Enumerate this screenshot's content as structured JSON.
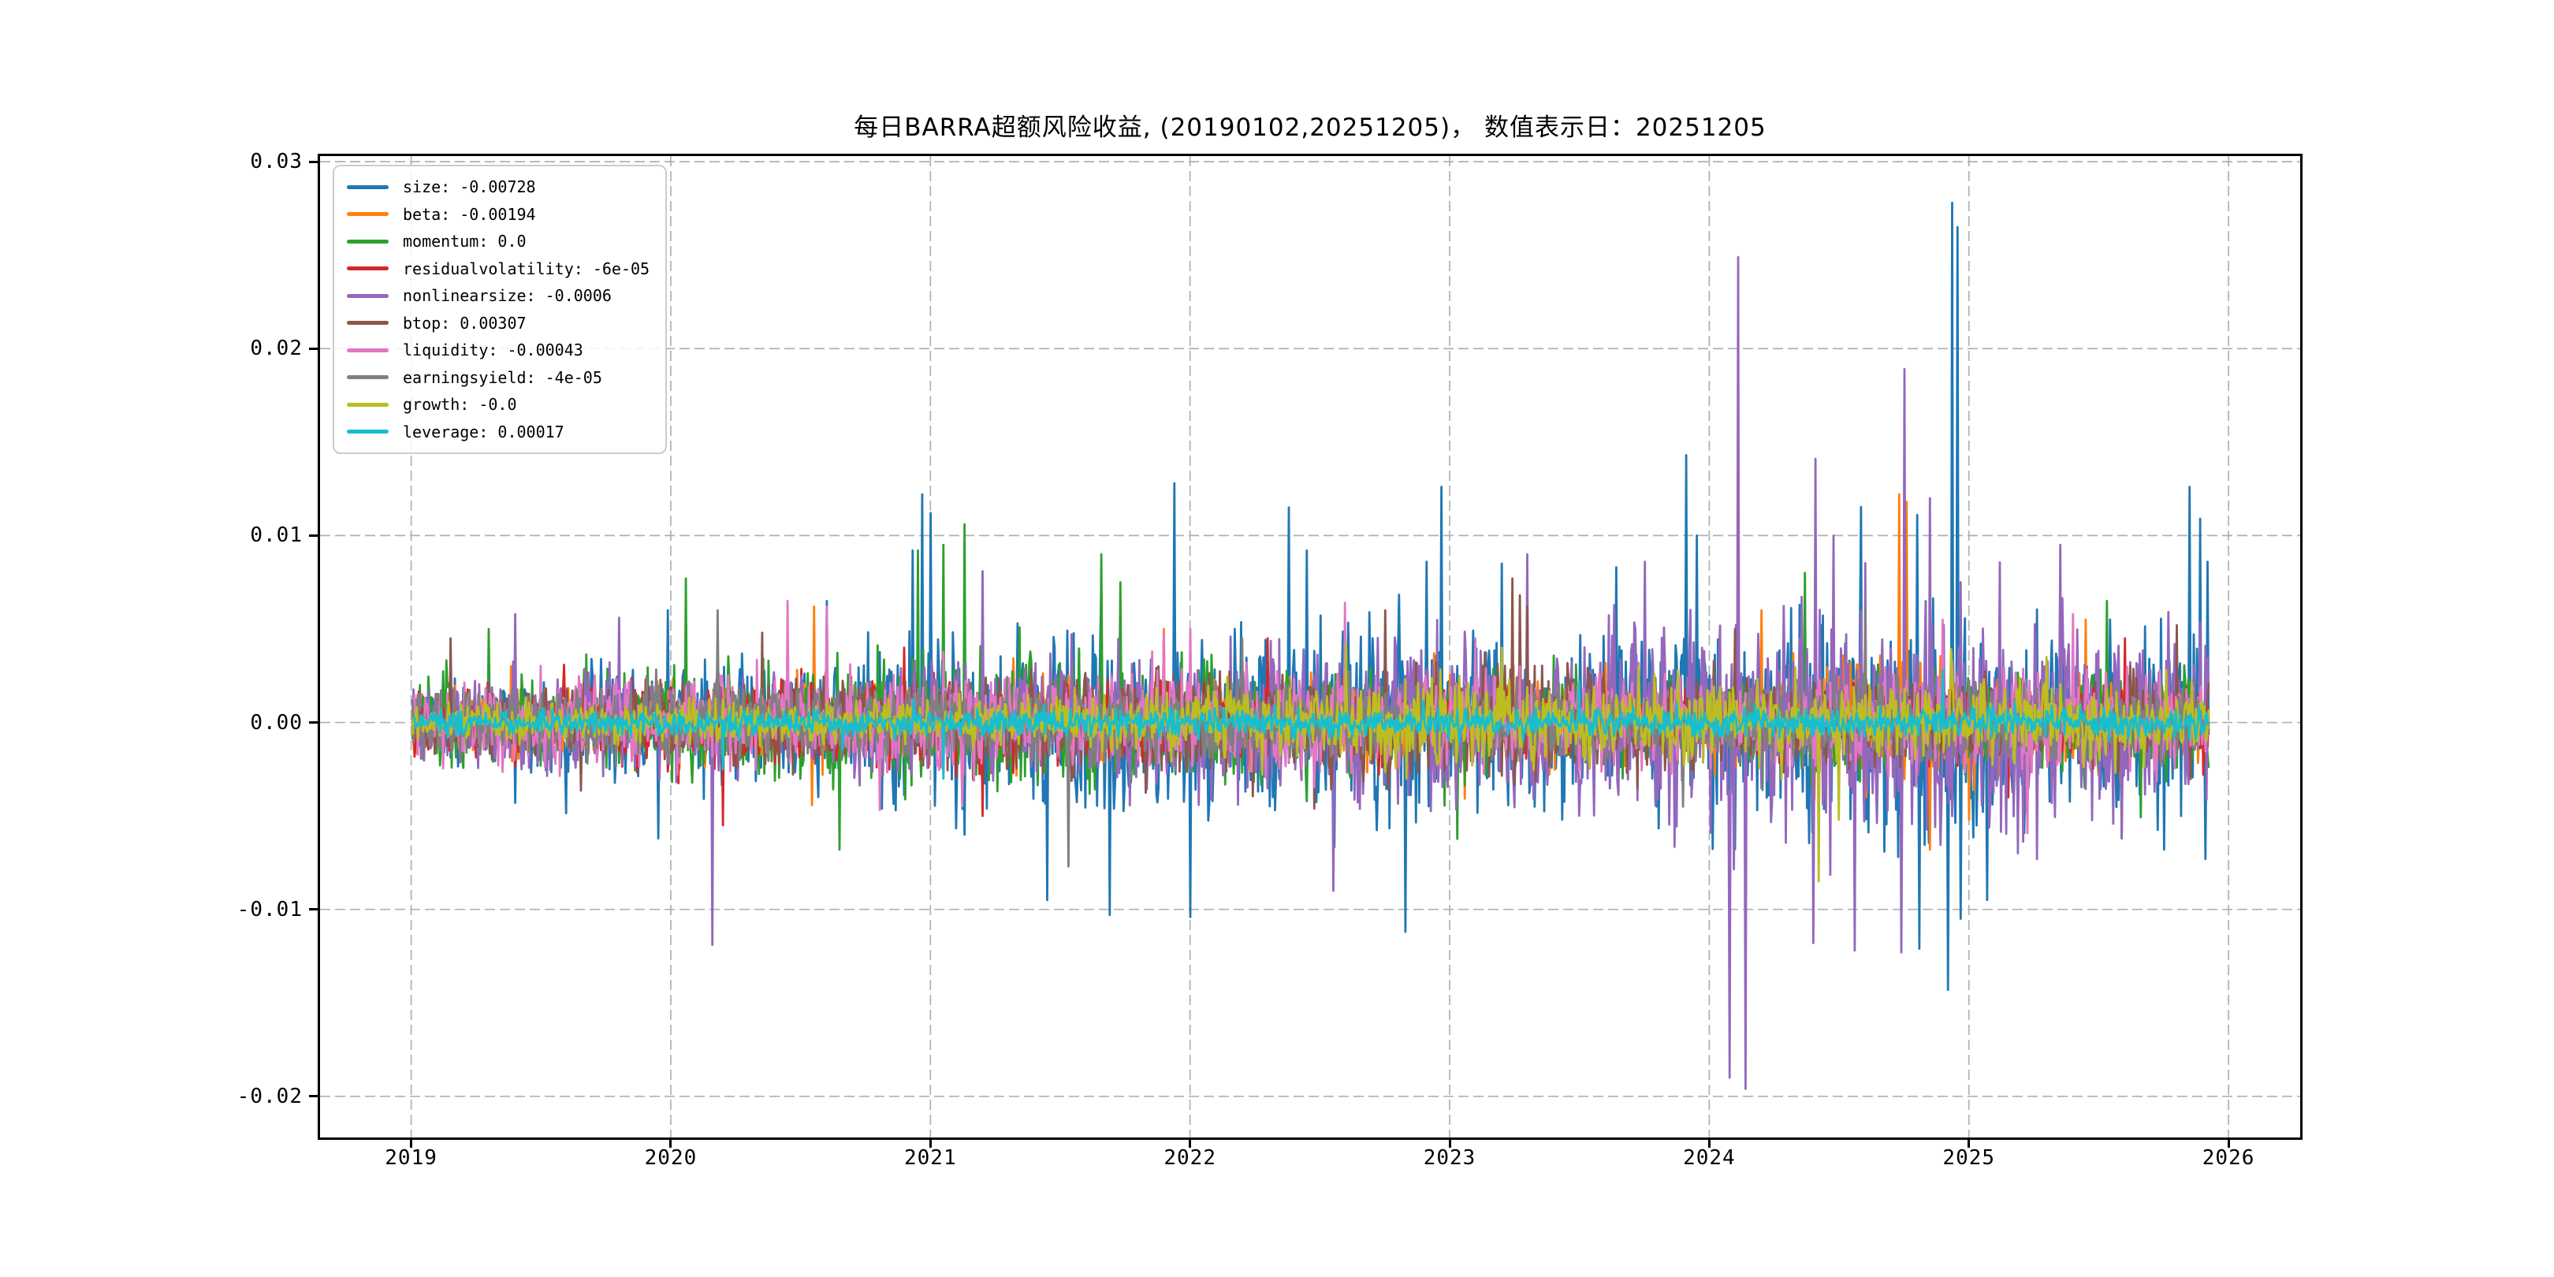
{
  "chart_data": {
    "type": "line",
    "title": "每日BARRA超额风险收益, (20190102,20251205)， 数值表示日：20251205",
    "xlabel": "",
    "ylabel": "",
    "date_range": [
      "20190102",
      "20251205"
    ],
    "value_date": "20251205",
    "x_axis": {
      "unit": "year",
      "ticks": [
        2019,
        2020,
        2021,
        2022,
        2023,
        2024,
        2025,
        2026
      ],
      "lim": [
        2018.649,
        2026.276
      ]
    },
    "y_axis": {
      "ticks": [
        0.03,
        0.02,
        0.01,
        0.0,
        -0.01,
        -0.02
      ],
      "tick_labels": [
        "0.03",
        "0.02",
        "0.01",
        "0.00",
        "-0.01",
        "-0.02"
      ],
      "lim": [
        -0.0222,
        0.0303
      ]
    },
    "grid": {
      "show": true,
      "style": "dashed",
      "color": "#b0b0b0"
    },
    "legend": {
      "position": "upper left"
    },
    "points_per_year": 245,
    "data_start": 2019.005,
    "data_end": 2025.925,
    "series": [
      {
        "name": "size",
        "color": "#1f77b4",
        "last_value": -0.00728,
        "label": "size: -0.00728",
        "amp_envelope": [
          [
            2018.99,
            0.0011
          ],
          [
            2019.9,
            0.0013
          ],
          [
            2020.5,
            0.0016
          ],
          [
            2020.9,
            0.0022
          ],
          [
            2021.5,
            0.0024
          ],
          [
            2022.0,
            0.0024
          ],
          [
            2022.9,
            0.0026
          ],
          [
            2023.5,
            0.0024
          ],
          [
            2024.0,
            0.0026
          ],
          [
            2024.8,
            0.003
          ],
          [
            2025.3,
            0.0024
          ],
          [
            2025.93,
            0.0026
          ]
        ],
        "spikes": [
          [
            2019.4,
            -0.0043
          ],
          [
            2019.95,
            -0.0062
          ],
          [
            2019.99,
            0.006
          ],
          [
            2020.6,
            0.0065
          ],
          [
            2020.93,
            0.0092
          ],
          [
            2020.97,
            0.0122
          ],
          [
            2021.0,
            0.0112
          ],
          [
            2021.13,
            -0.006
          ],
          [
            2021.45,
            -0.0095
          ],
          [
            2021.69,
            -0.0103
          ],
          [
            2021.94,
            0.0128
          ],
          [
            2022.0,
            -0.0104
          ],
          [
            2022.38,
            0.0115
          ],
          [
            2022.45,
            0.0092
          ],
          [
            2022.83,
            -0.0112
          ],
          [
            2022.91,
            0.0086
          ],
          [
            2022.97,
            0.0126
          ],
          [
            2023.2,
            0.0085
          ],
          [
            2023.64,
            0.0083
          ],
          [
            2023.91,
            0.0143
          ],
          [
            2023.95,
            0.01
          ],
          [
            2024.41,
            0.0095
          ],
          [
            2024.8,
            0.0111
          ],
          [
            2024.81,
            -0.0121
          ],
          [
            2024.92,
            -0.0143
          ],
          [
            2024.935,
            0.0278
          ],
          [
            2024.955,
            0.0265
          ],
          [
            2024.97,
            -0.0105
          ],
          [
            2025.07,
            -0.0095
          ],
          [
            2025.59,
            -0.0062
          ],
          [
            2025.75,
            -0.0068
          ],
          [
            2025.85,
            0.0126
          ],
          [
            2025.89,
            0.0109
          ],
          [
            2025.91,
            -0.0073
          ],
          [
            2025.92,
            0.0086
          ]
        ]
      },
      {
        "name": "beta",
        "color": "#ff7f0e",
        "last_value": -0.00194,
        "label": "beta: -0.00194",
        "amp_envelope": [
          [
            2018.99,
            0.0008
          ],
          [
            2020.5,
            0.001
          ],
          [
            2022.0,
            0.001
          ],
          [
            2023.5,
            0.0011
          ],
          [
            2024.3,
            0.0013
          ],
          [
            2024.8,
            0.0018
          ],
          [
            2025.2,
            0.0013
          ],
          [
            2025.93,
            0.0012
          ]
        ],
        "spikes": [
          [
            2020.55,
            0.0062
          ],
          [
            2021.9,
            0.005
          ],
          [
            2023.3,
            0.005
          ],
          [
            2024.2,
            0.006
          ],
          [
            2024.73,
            0.0122
          ],
          [
            2024.76,
            0.0118
          ],
          [
            2024.85,
            -0.0068
          ],
          [
            2025.0,
            -0.0052
          ]
        ]
      },
      {
        "name": "momentum",
        "color": "#2ca02c",
        "last_value": 0.0,
        "label": "momentum: 0.0",
        "amp_envelope": [
          [
            2018.99,
            0.001
          ],
          [
            2019.9,
            0.0012
          ],
          [
            2020.6,
            0.0016
          ],
          [
            2021.3,
            0.0019
          ],
          [
            2021.8,
            0.0015
          ],
          [
            2022.5,
            0.0012
          ],
          [
            2023.5,
            0.0012
          ],
          [
            2024.5,
            0.0013
          ],
          [
            2025.93,
            0.0013
          ]
        ],
        "spikes": [
          [
            2019.3,
            0.005
          ],
          [
            2020.06,
            0.0077
          ],
          [
            2020.65,
            -0.0068
          ],
          [
            2020.95,
            0.0092
          ],
          [
            2021.05,
            0.0095
          ],
          [
            2021.13,
            0.0106
          ],
          [
            2021.66,
            0.009
          ],
          [
            2021.73,
            0.0075
          ],
          [
            2024.37,
            0.008
          ],
          [
            2025.53,
            0.0065
          ]
        ]
      },
      {
        "name": "residualvolatility",
        "color": "#d62728",
        "last_value": -6e-05,
        "label": "residualvolatility: -6e-05",
        "amp_envelope": [
          [
            2018.99,
            0.0008
          ],
          [
            2020.3,
            0.0012
          ],
          [
            2021.5,
            0.0011
          ],
          [
            2022.5,
            0.0009
          ],
          [
            2023.5,
            0.0008
          ],
          [
            2024.5,
            0.0009
          ],
          [
            2025.93,
            0.001
          ]
        ],
        "spikes": [
          [
            2020.2,
            -0.0055
          ],
          [
            2020.9,
            0.004
          ],
          [
            2021.2,
            -0.005
          ],
          [
            2022.3,
            0.0045
          ],
          [
            2025.15,
            -0.004
          ],
          [
            2025.6,
            0.0045
          ]
        ]
      },
      {
        "name": "nonlinearsize",
        "color": "#9467bd",
        "last_value": -0.0006,
        "label": "nonlinearsize: -0.0006",
        "amp_envelope": [
          [
            2018.99,
            0.0011
          ],
          [
            2020.2,
            0.0014
          ],
          [
            2021.0,
            0.0014
          ],
          [
            2022.0,
            0.0018
          ],
          [
            2023.0,
            0.002
          ],
          [
            2023.8,
            0.0026
          ],
          [
            2024.3,
            0.0034
          ],
          [
            2024.9,
            0.003
          ],
          [
            2025.5,
            0.0026
          ],
          [
            2025.93,
            0.0022
          ]
        ],
        "spikes": [
          [
            2019.4,
            0.0058
          ],
          [
            2019.8,
            0.0056
          ],
          [
            2020.16,
            -0.0119
          ],
          [
            2021.2,
            0.0081
          ],
          [
            2022.55,
            -0.009
          ],
          [
            2023.3,
            0.009
          ],
          [
            2023.75,
            0.0086
          ],
          [
            2024.08,
            -0.019
          ],
          [
            2024.11,
            0.0249
          ],
          [
            2024.14,
            -0.0196
          ],
          [
            2024.4,
            -0.0118
          ],
          [
            2024.41,
            0.0141
          ],
          [
            2024.48,
            0.01
          ],
          [
            2024.56,
            -0.0122
          ],
          [
            2024.74,
            -0.0123
          ],
          [
            2024.75,
            0.0189
          ],
          [
            2024.85,
            0.012
          ],
          [
            2024.97,
            0.0075
          ],
          [
            2025.19,
            -0.007
          ],
          [
            2025.35,
            0.0095
          ],
          [
            2025.59,
            -0.0062
          ]
        ]
      },
      {
        "name": "btop",
        "color": "#8c564b",
        "last_value": 0.00307,
        "label": "btop: 0.00307",
        "amp_envelope": [
          [
            2018.99,
            0.0009
          ],
          [
            2020.0,
            0.001
          ],
          [
            2021.0,
            0.0011
          ],
          [
            2022.0,
            0.0013
          ],
          [
            2023.3,
            0.0014
          ],
          [
            2024.0,
            0.0011
          ],
          [
            2025.93,
            0.001
          ]
        ],
        "spikes": [
          [
            2019.15,
            0.0045
          ],
          [
            2020.35,
            0.0048
          ],
          [
            2022.75,
            0.006
          ],
          [
            2023.24,
            0.0077
          ],
          [
            2023.27,
            0.0068
          ],
          [
            2023.3,
            0.0062
          ],
          [
            2024.1,
            0.005
          ],
          [
            2025.8,
            0.0052
          ]
        ]
      },
      {
        "name": "liquidity",
        "color": "#e377c2",
        "last_value": -0.00043,
        "label": "liquidity: -0.00043",
        "amp_envelope": [
          [
            2018.99,
            0.001
          ],
          [
            2020.5,
            0.0013
          ],
          [
            2021.5,
            0.0012
          ],
          [
            2022.5,
            0.0012
          ],
          [
            2024.0,
            0.0012
          ],
          [
            2025.93,
            0.0012
          ]
        ],
        "spikes": [
          [
            2020.45,
            0.0065
          ],
          [
            2020.6,
            0.0062
          ],
          [
            2021.9,
            0.0048
          ],
          [
            2022.0,
            0.005
          ],
          [
            2023.1,
            0.0045
          ],
          [
            2024.9,
            0.0055
          ],
          [
            2025.4,
            0.0058
          ]
        ]
      },
      {
        "name": "earningsyield",
        "color": "#7f7f7f",
        "last_value": -4e-05,
        "label": "earningsyield: -4e-05",
        "amp_envelope": [
          [
            2018.99,
            0.0008
          ],
          [
            2020.3,
            0.001
          ],
          [
            2022.0,
            0.0009
          ],
          [
            2023.5,
            0.0009
          ],
          [
            2024.5,
            0.001
          ],
          [
            2025.93,
            0.0009
          ]
        ],
        "spikes": [
          [
            2020.18,
            0.006
          ],
          [
            2021.53,
            -0.0077
          ],
          [
            2022.2,
            0.0045
          ],
          [
            2023.9,
            -0.0045
          ],
          [
            2024.6,
            0.0062
          ]
        ]
      },
      {
        "name": "growth",
        "color": "#bcbd22",
        "last_value": -0.0,
        "label": "growth: -0.0",
        "amp_envelope": [
          [
            2018.99,
            0.0005
          ],
          [
            2021.5,
            0.0006
          ],
          [
            2022.3,
            0.001
          ],
          [
            2023.5,
            0.0011
          ],
          [
            2024.5,
            0.001
          ],
          [
            2025.93,
            0.0009
          ]
        ],
        "spikes": [
          [
            2022.6,
            0.0042
          ],
          [
            2023.2,
            0.004
          ],
          [
            2024.42,
            -0.0085
          ],
          [
            2024.5,
            -0.0052
          ],
          [
            2025.3,
            0.0035
          ]
        ]
      },
      {
        "name": "leverage",
        "color": "#17becf",
        "last_value": 0.00017,
        "label": "leverage: 0.00017",
        "amp_envelope": [
          [
            2018.99,
            0.0003
          ],
          [
            2021.0,
            0.00035
          ],
          [
            2023.0,
            0.00035
          ],
          [
            2025.93,
            0.0004
          ]
        ],
        "spikes": [
          [
            2020.2,
            -0.0025
          ],
          [
            2021.05,
            -0.003
          ],
          [
            2023.5,
            0.0022
          ],
          [
            2024.9,
            0.0028
          ]
        ]
      }
    ]
  }
}
